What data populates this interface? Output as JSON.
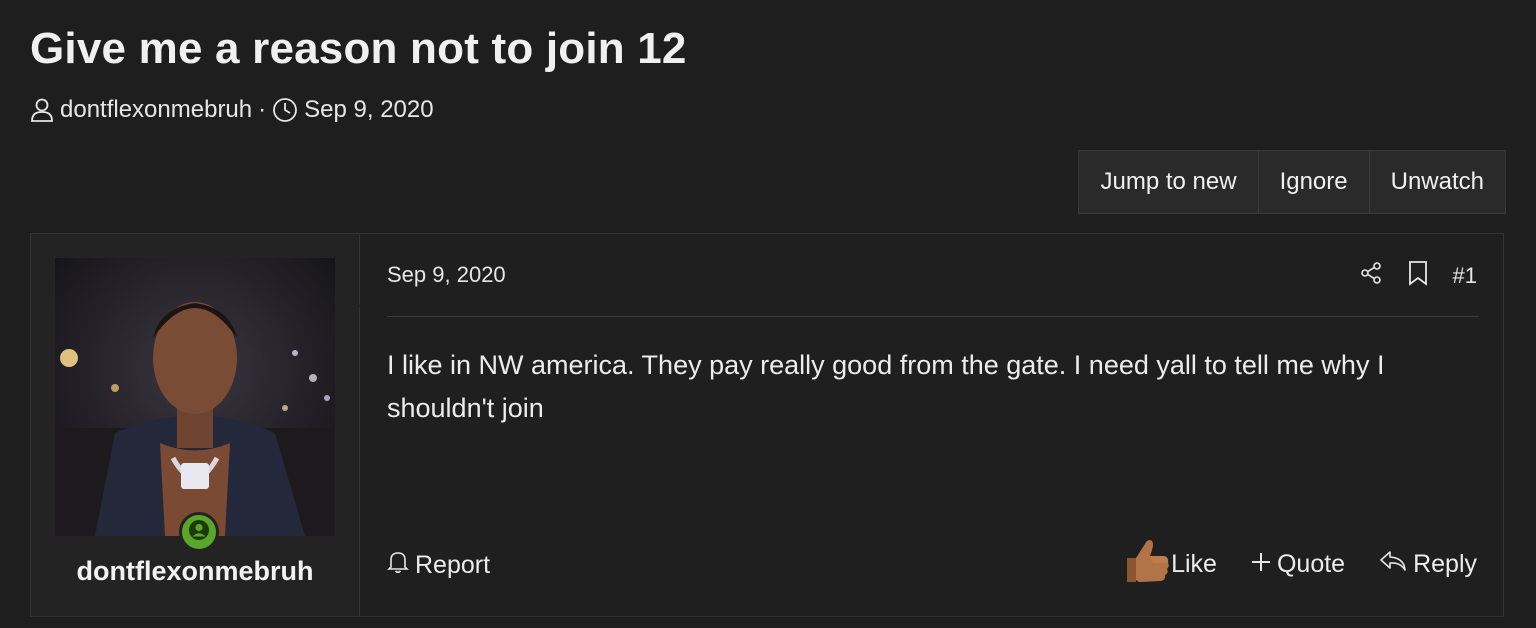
{
  "thread": {
    "title": "Give me a reason not to join 12",
    "author": "dontflexonmebruh",
    "separator": "·",
    "date": "Sep 9, 2020"
  },
  "thread_actions": {
    "jump_to_new": "Jump to new",
    "ignore": "Ignore",
    "unwatch": "Unwatch"
  },
  "post": {
    "username": "dontflexonmebruh",
    "date": "Sep 9, 2020",
    "number": "#1",
    "body": "I like in NW america. They pay really good from the gate. I need yall to tell me why I shouldn't join",
    "report": "Report",
    "like": "Like",
    "quote": "Quote",
    "reply": "Reply",
    "online_status_color": "#5aa62a"
  },
  "icons": [
    "user-icon",
    "clock-icon",
    "share-icon",
    "bookmark-icon",
    "bell-icon",
    "thumbs-up-icon",
    "plus-icon",
    "reply-icon",
    "online-user-icon"
  ]
}
